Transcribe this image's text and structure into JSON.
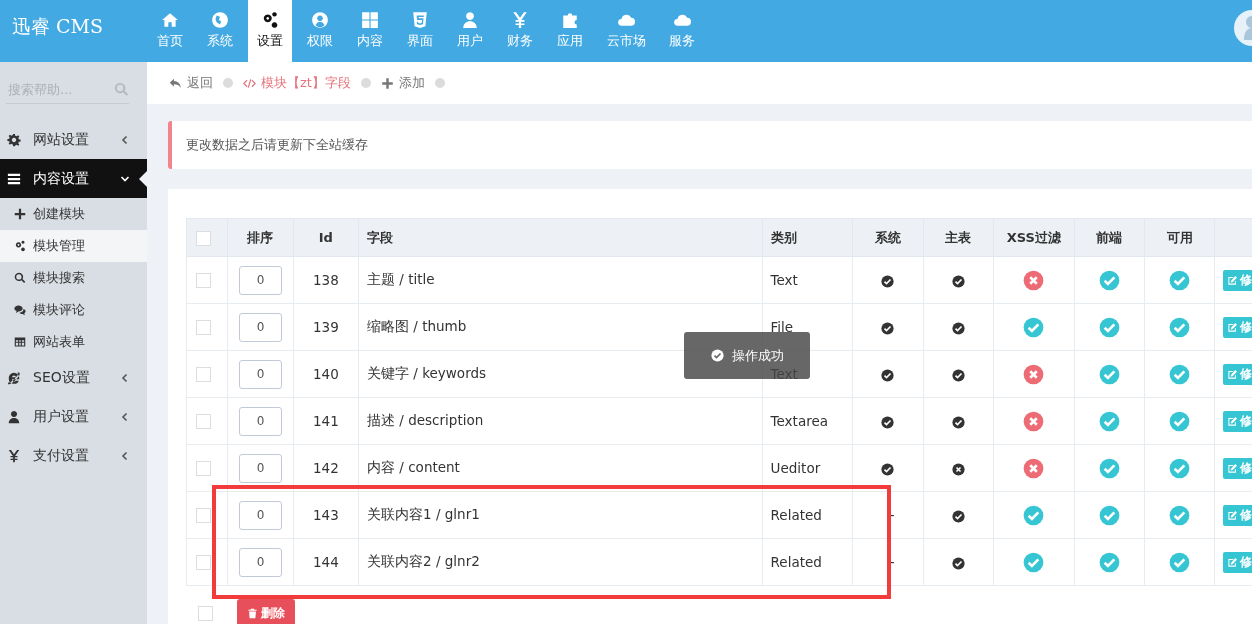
{
  "logo": "迅睿 CMS",
  "nav": [
    {
      "label": "首页",
      "selected": false
    },
    {
      "label": "系统",
      "selected": false
    },
    {
      "label": "设置",
      "selected": true
    },
    {
      "label": "权限",
      "selected": false
    },
    {
      "label": "内容",
      "selected": false
    },
    {
      "label": "界面",
      "selected": false
    },
    {
      "label": "用户",
      "selected": false
    },
    {
      "label": "财务",
      "selected": false
    },
    {
      "label": "应用",
      "selected": false
    },
    {
      "label": "云市场",
      "selected": false
    },
    {
      "label": "服务",
      "selected": false
    }
  ],
  "search": {
    "placeholder": "搜索帮助..."
  },
  "sidebar": {
    "items": [
      {
        "label": "网站设置",
        "expanded": false
      },
      {
        "label": "内容设置",
        "expanded": true,
        "children": [
          {
            "label": "创建模块",
            "selected": false
          },
          {
            "label": "模块管理",
            "selected": true
          },
          {
            "label": "模块搜索",
            "selected": false
          },
          {
            "label": "模块评论",
            "selected": false
          },
          {
            "label": "网站表单",
            "selected": false
          }
        ]
      },
      {
        "label": "SEO设置",
        "expanded": false
      },
      {
        "label": "用户设置",
        "expanded": false
      },
      {
        "label": "支付设置",
        "expanded": false
      }
    ]
  },
  "breadcrumb": {
    "back": "返回",
    "current": "模块【zt】字段",
    "add": "添加"
  },
  "alert": "更改数据之后请更新下全站缓存",
  "table": {
    "columns": [
      "排序",
      "Id",
      "字段",
      "类别",
      "系统",
      "主表",
      "XSS过滤",
      "前端",
      "可用"
    ],
    "rows": [
      {
        "order": "0",
        "id": "138",
        "field": "主题 / title",
        "type": "Text",
        "system": true,
        "main": true,
        "xss": false,
        "front": true,
        "usable": true,
        "action": "修",
        "highlighted": false,
        "checked": false
      },
      {
        "order": "0",
        "id": "139",
        "field": "缩略图 / thumb",
        "type": "File",
        "system": true,
        "main": true,
        "xss": true,
        "front": true,
        "usable": true,
        "action": "修",
        "highlighted": false,
        "checked": false
      },
      {
        "order": "0",
        "id": "140",
        "field": "关键字 / keywords",
        "type": "Text",
        "system": true,
        "main": true,
        "xss": false,
        "front": true,
        "usable": true,
        "action": "修",
        "highlighted": false,
        "checked": false
      },
      {
        "order": "0",
        "id": "141",
        "field": "描述 / description",
        "type": "Textarea",
        "system": true,
        "main": true,
        "xss": false,
        "front": true,
        "usable": true,
        "action": "修",
        "highlighted": false,
        "checked": false
      },
      {
        "order": "0",
        "id": "142",
        "field": "内容 / content",
        "type": "Ueditor",
        "system": true,
        "main": false,
        "xss": false,
        "front": true,
        "usable": true,
        "action": "修",
        "highlighted": false,
        "checked": false
      },
      {
        "order": "0",
        "id": "143",
        "field": "关联内容1 / glnr1",
        "type": "Related",
        "system_text": "-",
        "main": true,
        "xss": true,
        "front": true,
        "usable": true,
        "action": "修",
        "highlighted": true,
        "checked": false
      },
      {
        "order": "0",
        "id": "144",
        "field": "关联内容2 / glnr2",
        "type": "Related",
        "system_text": "-",
        "main": true,
        "xss": true,
        "front": true,
        "usable": true,
        "action": "修",
        "highlighted": true,
        "checked": false
      }
    ]
  },
  "header_checkbox": {
    "checked": false
  },
  "footer_checkbox": {
    "checked": false
  },
  "delete_button": "删除",
  "toast": "操作成功"
}
